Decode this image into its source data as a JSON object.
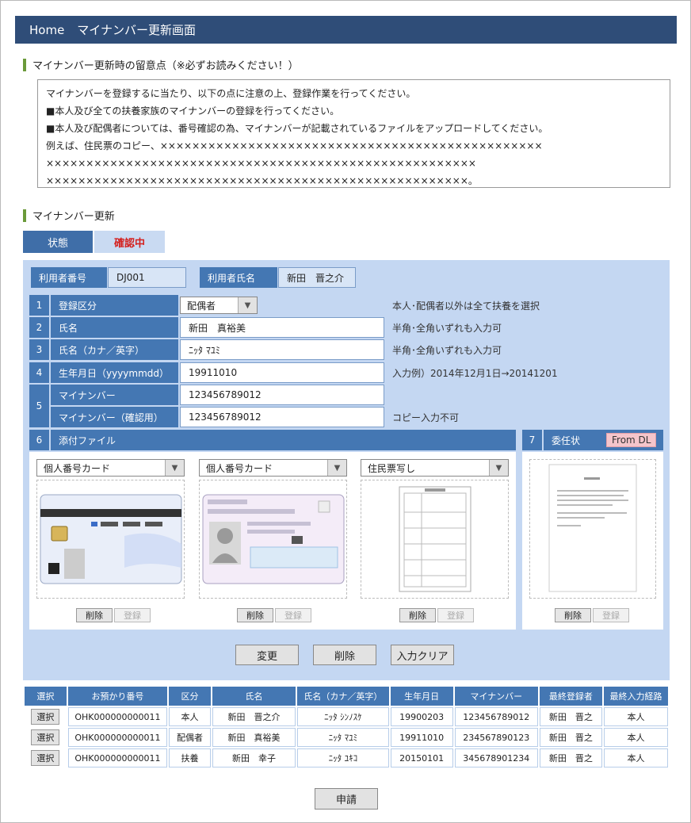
{
  "header": {
    "home": "Home",
    "title": "マイナンバー更新画面"
  },
  "notice": {
    "title": "マイナンバー更新時の留意点（※必ずお読みください！）",
    "lines": [
      "マイナンバーを登録するに当たり、以下の点に注意の上、登録作業を行ってください。",
      "■本人及び全ての扶養家族のマイナンバーの登録を行ってください。",
      "■本人及び配偶者については、番号確認の為、マイナンバーが記載されているファイルをアップロードしてください。",
      " 例えば、住民票のコピー、××××××××××××××××××××××××××××××××××××××××××××××××",
      " ××××××××××××××××××××××××××××××××××××××××××××××××××××××",
      " ×××××××××××××××××××××××××××××××××××××××××××××××××××××。"
    ]
  },
  "section": {
    "title": "マイナンバー更新"
  },
  "status": {
    "label": "状態",
    "value": "確認中"
  },
  "user": {
    "id_label": "利用者番号",
    "id_value": "DJ001",
    "name_label": "利用者氏名",
    "name_value": "新田　晋之介"
  },
  "form": {
    "rows": [
      {
        "num": "1",
        "label": "登録区分",
        "value": "配偶者",
        "hint": "本人･配偶者以外は全て扶養を選択"
      },
      {
        "num": "2",
        "label": "氏名",
        "value": "新田　真裕美",
        "hint": "半角･全角いずれも入力可"
      },
      {
        "num": "3",
        "label": "氏名（カナ／英字）",
        "value": "ﾆｯﾀ ﾏﾕﾐ",
        "hint": "半角･全角いずれも入力可"
      },
      {
        "num": "4",
        "label": "生年月日（yyyymmdd）",
        "value": "19911010",
        "hint": "入力例）2014年12月1日→20141201"
      },
      {
        "num": "5",
        "label": "マイナンバー",
        "value": "123456789012",
        "hint": ""
      },
      {
        "num": "",
        "label": "マイナンバー（確認用）",
        "value": "123456789012",
        "hint": "コピー入力不可"
      }
    ],
    "attach": {
      "num": "6",
      "label": "添付ファイル"
    },
    "proxy": {
      "num": "7",
      "label": "委任状",
      "dl": "From DL"
    },
    "files": [
      {
        "type": "個人番号カード"
      },
      {
        "type": "個人番号カード"
      },
      {
        "type": "住民票写し"
      }
    ],
    "delete_label": "削除",
    "register_label": "登録",
    "buttons": {
      "change": "変更",
      "delete": "削除",
      "clear": "入力クリア"
    }
  },
  "table": {
    "headers": [
      "選択",
      "お預かり番号",
      "区分",
      "氏名",
      "氏名（カナ／英字）",
      "生年月日",
      "マイナンバー",
      "最終登録者",
      "最終入力経路"
    ],
    "select_label": "選択",
    "rows": [
      [
        "OHK000000000011",
        "本人",
        "新田　晋之介",
        "ﾆｯﾀ ｼﾝﾉｽｹ",
        "19900203",
        "123456789012",
        "新田　晋之",
        "本人"
      ],
      [
        "OHK000000000011",
        "配偶者",
        "新田　真裕美",
        "ﾆｯﾀ ﾏﾕﾐ",
        "19911010",
        "234567890123",
        "新田　晋之",
        "本人"
      ],
      [
        "OHK000000000011",
        "扶養",
        "新田　幸子",
        "ﾆｯﾀ ﾕｷｺ",
        "20150101",
        "345678901234",
        "新田　晋之",
        "本人"
      ]
    ]
  },
  "apply_label": "申請"
}
